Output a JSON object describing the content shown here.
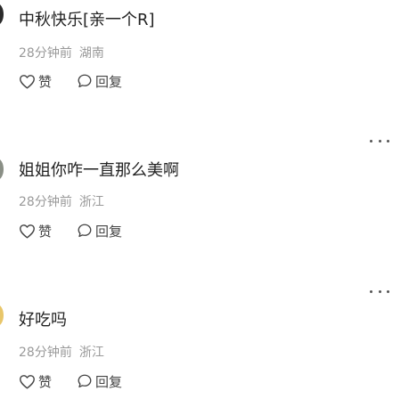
{
  "comments": [
    {
      "text": "中秋快乐[亲一个R]",
      "time": "28分钟前",
      "region": "湖南",
      "like_label": "赞",
      "reply_label": "回复",
      "avatar_color": "#2b2b2b"
    },
    {
      "text": "姐姐你咋一直那么美啊",
      "time": "28分钟前",
      "region": "浙江",
      "like_label": "赞",
      "reply_label": "回复",
      "avatar_color": "#8a8f86"
    },
    {
      "text": "好吃吗",
      "time": "28分钟前",
      "region": "浙江",
      "like_label": "赞",
      "reply_label": "回复",
      "avatar_color": "#e8c66a"
    }
  ],
  "more_icon": "ellipsis-icon",
  "like_icon": "heart-outline-icon",
  "reply_icon": "speech-bubble-icon"
}
